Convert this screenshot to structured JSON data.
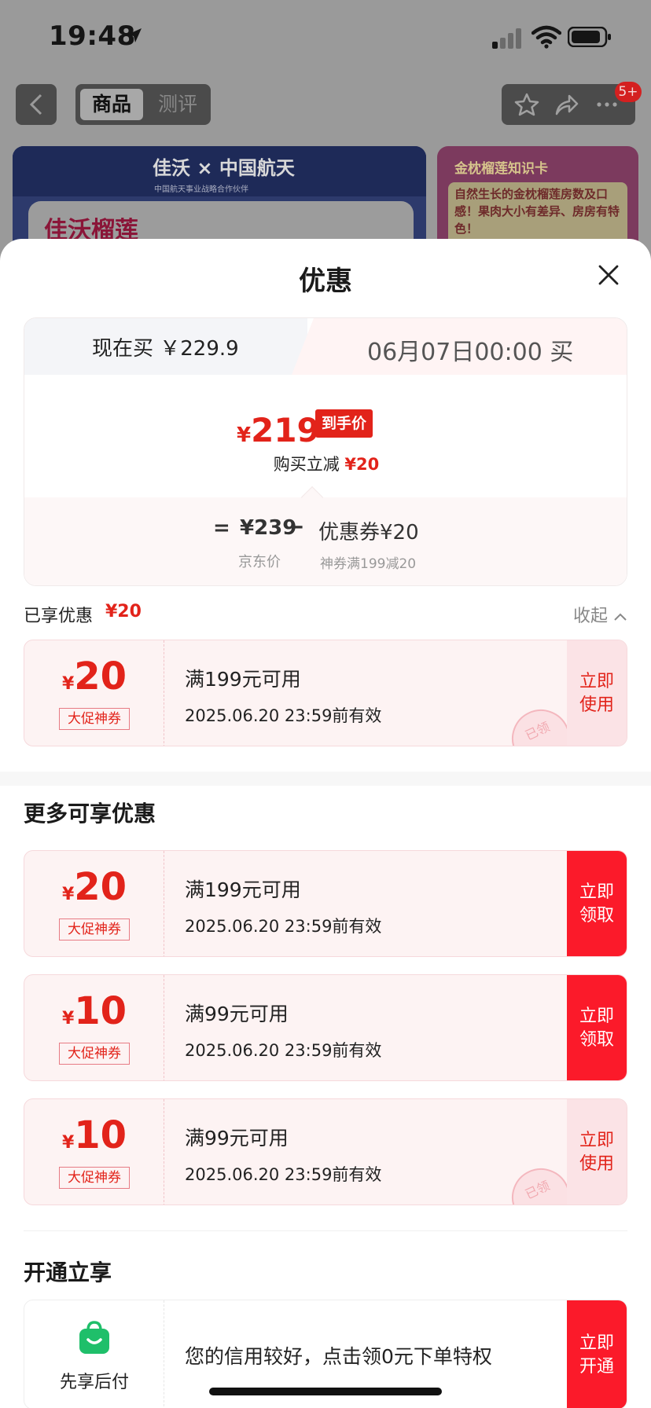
{
  "status_bar": {
    "time": "19:48"
  },
  "nav": {
    "tab_product": "商品",
    "tab_review": "测评",
    "badge": "5+"
  },
  "banner": {
    "brand": "佳沃 × 中国航天",
    "sub": "中国航天事业战略合作伙伴",
    "title": "佳沃榴莲",
    "right_title": "金枕榴莲知识卡",
    "right_text": "自然生长的金枕榴莲房数及口感！果肉大小有差异、房房有特色！"
  },
  "sheet": {
    "title": "优惠"
  },
  "compare": {
    "tab_now": "现在买 ￥229.9",
    "tab_later": "06月07日00:00 买",
    "final_yen": "¥",
    "final_price": "219",
    "final_tag": "到手价",
    "cut_label": "购买立减",
    "cut_amount": "¥20",
    "eq": "=",
    "jd_price": "¥239",
    "minus": "–",
    "coupon_part": "优惠券¥20",
    "jd_label": "京东价",
    "coupon_label": "神券满199减20"
  },
  "enjoyed": {
    "label": "已享优惠",
    "amount": "¥20",
    "collapse": "收起"
  },
  "applied_coupon": {
    "yen": "¥",
    "amount": "20",
    "type": "大促神券",
    "condition": "满199元可用",
    "expiry": "2025.06.20 23:59前有效",
    "button": "立即使用",
    "stamp": "已领"
  },
  "more": {
    "title": "更多可享优惠",
    "coupons": [
      {
        "yen": "¥",
        "amount": "20",
        "type": "大促神券",
        "condition": "满199元可用",
        "expiry": "2025.06.20 23:59前有效",
        "button": "立即领取"
      },
      {
        "yen": "¥",
        "amount": "10",
        "type": "大促神券",
        "condition": "满99元可用",
        "expiry": "2025.06.20 23:59前有效",
        "button": "立即领取"
      },
      {
        "yen": "¥",
        "amount": "10",
        "type": "大促神券",
        "condition": "满99元可用",
        "expiry": "2025.06.20 23:59前有效",
        "button": "立即使用",
        "stamp": "已领"
      }
    ]
  },
  "open": {
    "title": "开通立享",
    "label": "先享后付",
    "text": "您的信用较好，点击领0元下单特权",
    "button": "立即开通"
  },
  "colors": {
    "accent": "#e2231a",
    "button_red": "#fb1a2a"
  }
}
